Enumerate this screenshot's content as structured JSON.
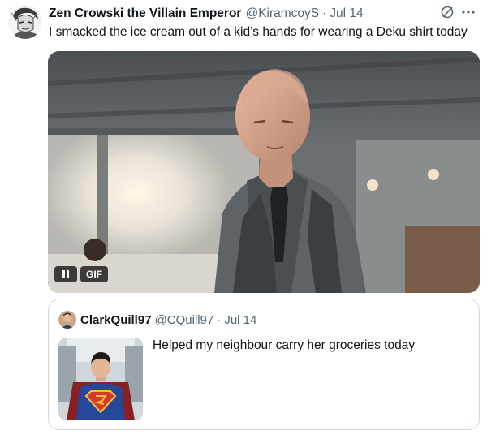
{
  "tweet": {
    "author_name": "Zen Crowski the Villain Emperor",
    "handle": "@KiramcoyS",
    "separator": "·",
    "date": "Jul 14",
    "text": "I smacked the ice cream out of a kid’s hands for wearing a Deku shirt today",
    "icons": [
      "grok-icon",
      "more-icon"
    ]
  },
  "media": {
    "type": "gif",
    "badge_label": "GIF",
    "controls": [
      "pause-icon"
    ]
  },
  "quoted_tweet": {
    "author_name": "ClarkQuill97",
    "handle": "@CQuill97",
    "separator": "·",
    "date": "Jul 14",
    "text": "Helped my neighbour carry her groceries today"
  }
}
